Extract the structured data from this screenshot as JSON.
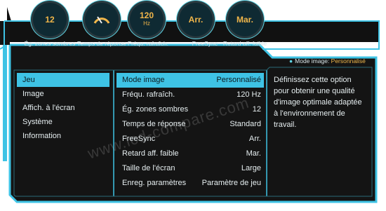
{
  "gauges": [
    {
      "value": "12",
      "sub": "",
      "label": "Ég. zones sombres"
    },
    {
      "value": "",
      "sub": "",
      "label": "Temps de réponse"
    },
    {
      "value": "120",
      "sub": "Hz",
      "label": "Fréqu. rafraîch."
    },
    {
      "value": "Arr.",
      "sub": "",
      "label": "FreeSync"
    },
    {
      "value": "Mar.",
      "sub": "",
      "label": "Retard aff. faible"
    }
  ],
  "mode_indicator": {
    "label": "Mode image:",
    "value": "Personnalisé"
  },
  "menu": [
    {
      "label": "Jeu"
    },
    {
      "label": "Image"
    },
    {
      "label": "Affich. à l'écran"
    },
    {
      "label": "Système"
    },
    {
      "label": "Information"
    }
  ],
  "settings": [
    {
      "label": "Mode image",
      "value": "Personnalisé"
    },
    {
      "label": "Fréqu. rafraîch.",
      "value": "120 Hz"
    },
    {
      "label": "Ég. zones sombres",
      "value": "12"
    },
    {
      "label": "Temps de réponse",
      "value": "Standard"
    },
    {
      "label": "FreeSync",
      "value": "Arr."
    },
    {
      "label": "Retard aff. faible",
      "value": "Mar."
    },
    {
      "label": "Taille de l'écran",
      "value": "Large"
    },
    {
      "label": "Enreg. paramètres",
      "value": "Paramètre de jeu"
    }
  ],
  "description": "Définissez cette option pour obtenir une qualité d'image optimale adaptée à l'environnement de travail.",
  "watermark": "www.lcd-compare.com",
  "colors": {
    "accent": "#3ec3e5",
    "value": "#f0b64a",
    "panel": "#141414"
  }
}
